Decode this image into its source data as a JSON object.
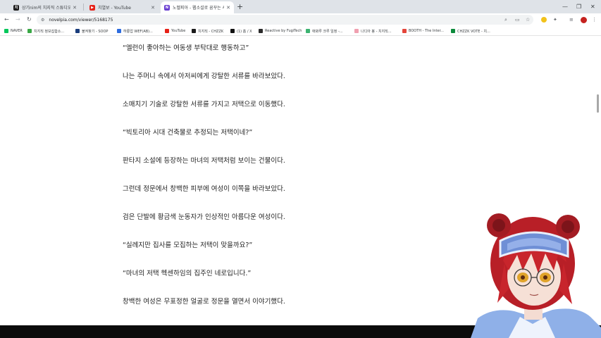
{
  "browser": {
    "tabs": [
      {
        "label": "상기nim의 치지직 스튜디오",
        "favicon_color": "#1b1b1b",
        "favicon_glyph": "치",
        "active": false
      },
      {
        "label": "치열보 - YouTube",
        "favicon_color": "#e62117",
        "favicon_glyph": "▶",
        "active": false
      },
      {
        "label": "노벨피아 - 웹소설로 꿈꾸는 세",
        "favicon_color": "#6a3fd1",
        "favicon_glyph": "N",
        "active": true
      }
    ],
    "address": "novelpia.com/viewer/5168175",
    "bookmarks": [
      {
        "label": "NAVER",
        "color": "#03c75a"
      },
      {
        "label": "치지직 정보집합소...",
        "color": "#39a845"
      },
      {
        "label": "불켜찾기 - SOOP",
        "color": "#1a3d7c"
      },
      {
        "label": "하롱업 WEF(AB)...",
        "color": "#2d6cdf"
      },
      {
        "label": "YouTube",
        "color": "#e62117"
      },
      {
        "label": "치지직 - CHZZK",
        "color": "#1b1b1b"
      },
      {
        "label": "(1) 홈 / X",
        "color": "#111111"
      },
      {
        "label": "Reactive by FugiTech",
        "color": "#2b2b2b"
      },
      {
        "label": "애봐루 크루 일정 -...",
        "color": "#3cb371"
      },
      {
        "label": "나디아 봉 - 치지직...",
        "color": "#f0a0b0"
      },
      {
        "label": "BOOTH - The Inter...",
        "color": "#e4453a"
      },
      {
        "label": "CHZZK VOTE - 치...",
        "color": "#0c8a3b"
      }
    ]
  },
  "novel": {
    "paragraphs": [
      "“엘런이 좋아하는 여동생 부탁대로 행동하고”",
      "나는 주머니 속에서 아저씨에게 강탈한 서류를 바라보았다.",
      "소매치기 기술로 강탈한 서류를 가지고 저택으로 이동했다.",
      "“빅토리아 시대 건축물로 추정되는 저택이네?”",
      "판타지 소설에 등장하는 마녀의 저택처럼 보이는 건물이다.",
      "그런데 정문에서 창백한 피부에 여성이 이쪽을 바라보았다.",
      "검은 단발에 황금색 눈동자가 인상적인 아름다운 여성이다.",
      "“실례지만 집사를 모집하는 저택이 맞을까요?”",
      "“마녀의 저택 헥센하임의 집주인 네로입니다.”",
      "창백한 여성은 무표정한 얼굴로 정문을 열면서 이야기했다."
    ]
  },
  "colors": {
    "page_bg": "#ffffff",
    "text": "#222222",
    "tabstrip_bg": "#dfe3e8",
    "omnibox_bg": "#f1f3f4",
    "avatar_hair": "#c8252c",
    "avatar_goggles": "#6f8fd6"
  }
}
